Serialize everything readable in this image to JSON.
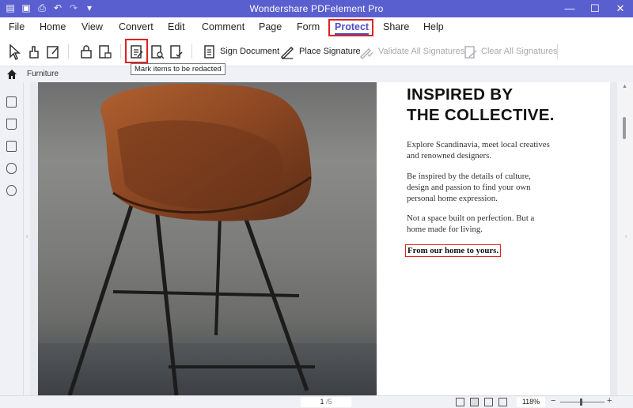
{
  "window": {
    "title": "Wondershare PDFelement Pro"
  },
  "quick_access": [
    "app-menu-icon",
    "save-icon",
    "print-icon",
    "undo-icon",
    "redo-icon",
    "customize-icon"
  ],
  "menu": {
    "items": [
      "File",
      "Home",
      "View",
      "Convert",
      "Edit",
      "Comment",
      "Page",
      "Form",
      "Protect",
      "Share",
      "Help"
    ],
    "active": "Protect"
  },
  "toolbar": {
    "sign_document": "Sign Document",
    "place_signature": "Place Signature",
    "validate_all": "Validate All Signatures",
    "clear_all": "Clear All Signatures",
    "tooltip": "Mark items to be redacted"
  },
  "tab": {
    "name": "Furniture"
  },
  "document": {
    "heading_line1": "INSPIRED BY",
    "heading_line2": "THE COLLECTIVE.",
    "para1_line1": "Explore Scandinavia, meet local creatives",
    "para1_line2": "and renowned designers.",
    "para2_line1": "Be inspired by the details of culture,",
    "para2_line2": "design and passion to find your own",
    "para2_line3": "personal home expression.",
    "para3_line1": "Not a space built on perfection. But a",
    "para3_line2": "home made for living.",
    "tagline": "From our home to yours."
  },
  "status": {
    "page_current": "1",
    "page_total": "/5",
    "zoom": "118%"
  },
  "colors": {
    "title_bar": "#5a5fcf",
    "accent": "#4a4fc2",
    "highlight_box": "#e02020"
  }
}
